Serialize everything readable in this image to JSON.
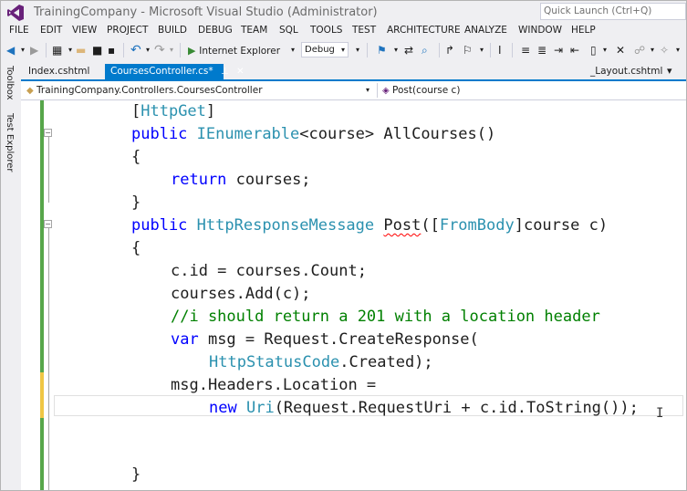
{
  "window": {
    "title": "TrainingCompany - Microsoft Visual Studio (Administrator)",
    "quick_launch_placeholder": "Quick Launch (Ctrl+Q)"
  },
  "menu": [
    "FILE",
    "EDIT",
    "VIEW",
    "PROJECT",
    "BUILD",
    "DEBUG",
    "TEAM",
    "SQL",
    "TOOLS",
    "TEST",
    "ARCHITECTURE",
    "ANALYZE",
    "WINDOW",
    "HELP"
  ],
  "toolbar": {
    "run_target": "Internet Explorer",
    "configuration": "Debug"
  },
  "left_dock": [
    "Toolbox",
    "Test Explorer"
  ],
  "tabs": {
    "index": "Index.cshtml",
    "active": "CoursesController.cs*",
    "layout": "_Layout.cshtml"
  },
  "navbar": {
    "type_path": "TrainingCompany.Controllers.CoursesController",
    "member": "Post(course c)"
  },
  "code": {
    "l1": [
      "[",
      "HttpGet",
      "]"
    ],
    "l2": [
      "public",
      " ",
      "IEnumerable",
      "<course> AllCourses()"
    ],
    "l3": "{",
    "l4": [
      "return",
      " courses;"
    ],
    "l5": "}",
    "l6": [
      "public",
      " ",
      "HttpResponseMessage",
      " ",
      "Post",
      "([",
      "FromBody",
      "]course c)"
    ],
    "l7": "{",
    "l8": "c.id = courses.Count;",
    "l9": "courses.Add(c);",
    "l10": "//i should return a 201 with a location header",
    "l11": [
      "var",
      " msg = Request.CreateResponse("
    ],
    "l12": [
      "HttpStatusCode",
      ".Created);"
    ],
    "l13": "msg.Headers.Location =",
    "l14": [
      "new",
      " ",
      "Uri",
      "(Request.RequestUri + c.id.ToString());"
    ],
    "l15": "}"
  },
  "colors": {
    "accent": "#007acc",
    "keyword": "#0000ff",
    "type": "#2b91af",
    "comment": "#008000",
    "changed_saved": "#57a64a",
    "changed_unsaved": "#efc644"
  }
}
